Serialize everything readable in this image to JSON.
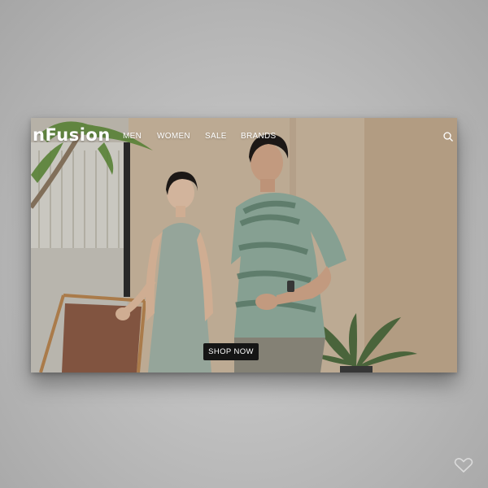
{
  "brand": {
    "logo_text": "nFusion"
  },
  "nav": {
    "items": [
      {
        "label": "MEN"
      },
      {
        "label": "WOMEN"
      },
      {
        "label": "SALE"
      },
      {
        "label": "BRANDS"
      }
    ],
    "search_icon": "search-icon"
  },
  "hero": {
    "cta_label": "SHOP NOW"
  },
  "icons": {
    "favorite": "heart-icon"
  },
  "colors": {
    "cta_background": "#151515",
    "nav_text": "#ffffff",
    "page_background": "#b9b9b9"
  }
}
